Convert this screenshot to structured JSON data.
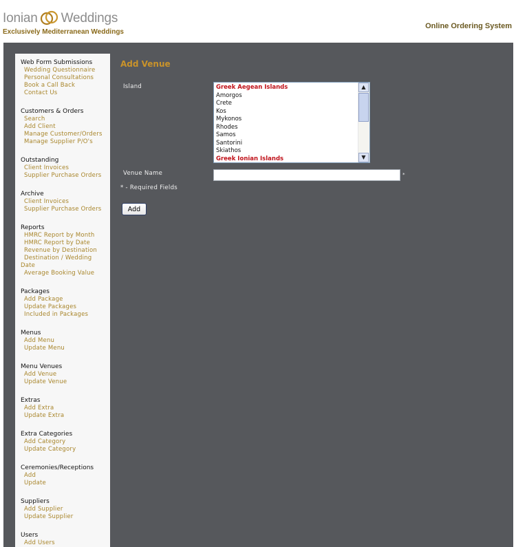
{
  "header": {
    "logo_left": "Ionian",
    "logo_right": "Weddings",
    "tagline": "Exclusively Mediterranean Weddings",
    "system_title": "Online Ordering System"
  },
  "sidebar": [
    {
      "title": "Web Form Submissions",
      "links": [
        "Wedding Questionnaire",
        "Personal Consultations",
        "Book a Call Back",
        "Contact Us"
      ]
    },
    {
      "title": "Customers & Orders",
      "links": [
        "Search",
        "Add Client",
        "Manage Customer/Orders",
        "Manage Supplier P/O's"
      ]
    },
    {
      "title": "Outstanding",
      "links": [
        "Client Invoices",
        "Supplier Purchase Orders"
      ]
    },
    {
      "title": "Archive",
      "links": [
        "Client Invoices",
        "Supplier Purchase Orders"
      ]
    },
    {
      "title": "Reports",
      "links": [
        "HMRC Report by Month",
        "HMRC Report by Date",
        "Revenue by Destination",
        "Destination / Wedding Date",
        "Average Booking Value"
      ]
    },
    {
      "title": "Packages",
      "links": [
        "Add Package",
        "Update Packages",
        "Included in Packages"
      ]
    },
    {
      "title": "Menus",
      "links": [
        "Add Menu",
        "Update Menu"
      ]
    },
    {
      "title": "Menu Venues",
      "links": [
        "Add Venue",
        "Update Venue"
      ]
    },
    {
      "title": "Extras",
      "links": [
        "Add Extra",
        "Update Extra"
      ]
    },
    {
      "title": "Extra Categories",
      "links": [
        "Add Category",
        "Update Category"
      ]
    },
    {
      "title": "Ceremonies/Receptions",
      "links": [
        "Add",
        "Update"
      ]
    },
    {
      "title": "Suppliers",
      "links": [
        "Add Supplier",
        "Update Supplier"
      ]
    },
    {
      "title": "Users",
      "links": [
        "Add Users"
      ]
    }
  ],
  "form": {
    "page_title": "Add Venue",
    "island_label": "Island",
    "island_options": [
      {
        "text": "Greek Aegean Islands",
        "group": true
      },
      {
        "text": "Amorgos",
        "group": false
      },
      {
        "text": "Crete",
        "group": false
      },
      {
        "text": "Kos",
        "group": false
      },
      {
        "text": "Mykonos",
        "group": false
      },
      {
        "text": "Rhodes",
        "group": false
      },
      {
        "text": "Samos",
        "group": false
      },
      {
        "text": "Santorini",
        "group": false
      },
      {
        "text": "Skiathos",
        "group": false
      },
      {
        "text": "Greek Ionian Islands",
        "group": true
      }
    ],
    "venue_label": "Venue Name",
    "venue_value": "",
    "required_marker": "*",
    "required_note": "* - Required Fields",
    "add_button": "Add"
  },
  "colors": {
    "content_background": "#56585c",
    "sidebar_background": "#f7f7f7",
    "link_color": "#a8852a",
    "title_color": "#c9932a",
    "group_option_color": "#c0121a"
  },
  "icons": {
    "scroll_up": "▲",
    "scroll_down": "▼"
  }
}
